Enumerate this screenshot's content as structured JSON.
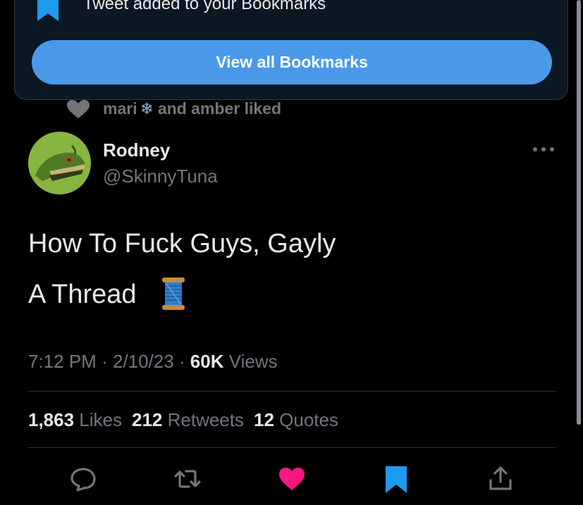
{
  "toast": {
    "message": "Tweet added to your Bookmarks",
    "button_label": "View all Bookmarks"
  },
  "social_context": {
    "name1": "mari",
    "emoji": "❄",
    "suffix": "and amber liked"
  },
  "author": {
    "name": "Rodney",
    "handle": "@SkinnyTuna"
  },
  "tweet": {
    "line1": "How To Fuck Guys, Gayly",
    "line2": "A Thread"
  },
  "meta": {
    "time": "7:12 PM",
    "sep1": " · ",
    "date": "2/10/23",
    "sep2": " · ",
    "views_count": "60K",
    "views_label": " Views"
  },
  "stats": {
    "likes_count": "1,863",
    "likes_label": " Likes",
    "retweets_count": "212",
    "retweets_label": " Retweets",
    "quotes_count": "12",
    "quotes_label": " Quotes"
  },
  "icons": {
    "bookmark": "bookmark-icon",
    "heart": "heart-icon",
    "reply": "reply-icon",
    "retweet": "retweet-icon",
    "like": "like-icon",
    "share": "share-icon",
    "more": "more-icon",
    "spool": "spool-emoji-icon"
  },
  "colors": {
    "accent": "#1d9bf0",
    "button": "#4a99e9",
    "like": "#f91880",
    "muted": "#71767b"
  }
}
